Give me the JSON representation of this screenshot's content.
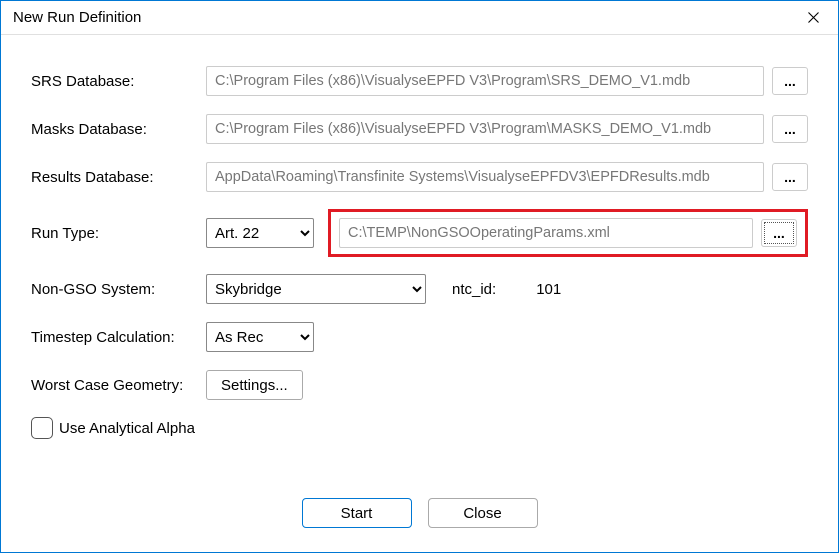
{
  "window": {
    "title": "New Run Definition"
  },
  "labels": {
    "srs": "SRS Database:",
    "masks": "Masks Database:",
    "results": "Results Database:",
    "runtype": "Run Type:",
    "nongso": "Non-GSO System:",
    "ntc_id": "ntc_id:",
    "timestep": "Timestep Calculation:",
    "wcg": "Worst Case Geometry:",
    "analytical": "Use Analytical Alpha"
  },
  "values": {
    "srs_path": "C:\\Program Files (x86)\\VisualyseEPFD V3\\Program\\SRS_DEMO_V1.mdb",
    "masks_path": "C:\\Program Files (x86)\\VisualyseEPFD V3\\Program\\MASKS_DEMO_V1.mdb",
    "results_path": "AppData\\Roaming\\Transfinite Systems\\VisualyseEPFDV3\\EPFDResults.mdb",
    "runtype": "Art. 22",
    "runtype_path": "C:\\TEMP\\NonGSOOperatingParams.xml",
    "system": "Skybridge",
    "ntc_id_value": "101",
    "timestep": "As Rec",
    "settings_btn": "Settings...",
    "browse": "...",
    "analytical_checked": false
  },
  "buttons": {
    "start": "Start",
    "close": "Close"
  }
}
